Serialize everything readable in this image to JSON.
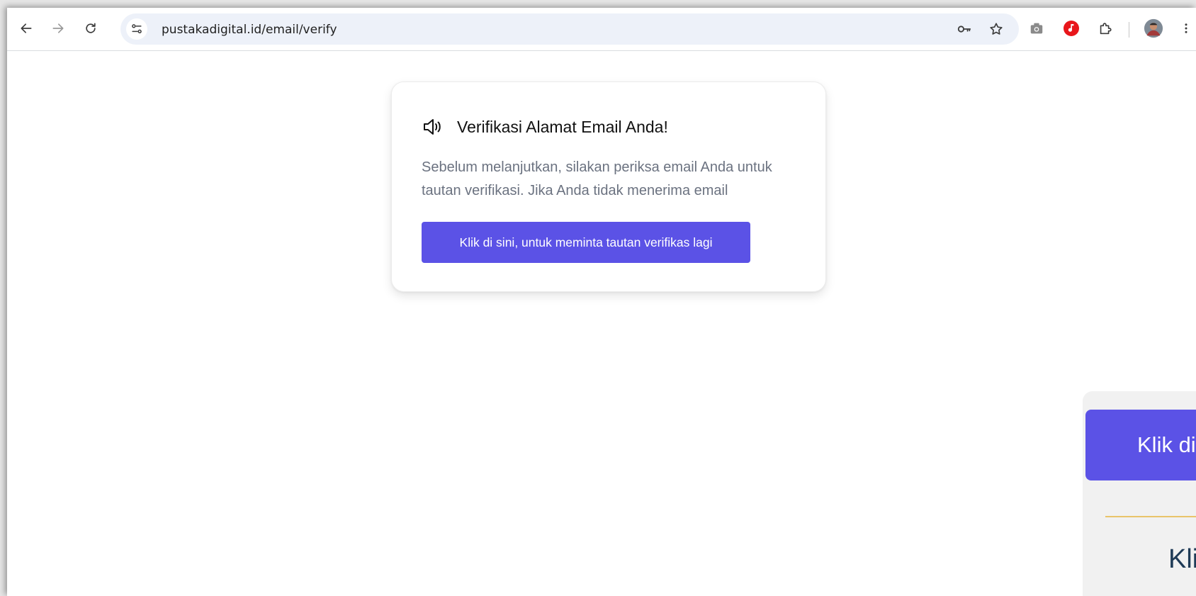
{
  "browser": {
    "url": "pustakadigital.id/email/verify"
  },
  "card": {
    "title": "Verifikasi Alamat Email Anda!",
    "text": "Sebelum melanjutkan, silakan periksa email Anda untuk tautan verifikasi. Jika Anda tidak menerima email",
    "button_label": "Klik di sini, untuk meminta tautan verifikas lagi"
  },
  "overlay": {
    "button_label": "Klik di",
    "text": "Kli"
  },
  "colors": {
    "accent": "#5b52e6",
    "muted_text": "#6b7280",
    "divider": "#e9c46a",
    "heading_blue": "#1f3b57"
  }
}
